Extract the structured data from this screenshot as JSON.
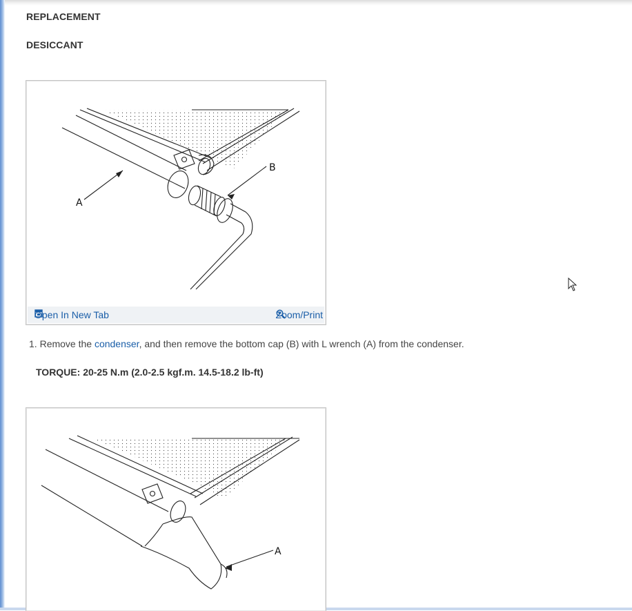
{
  "headings": {
    "replacement": "REPLACEMENT",
    "desiccant": "DESICCANT"
  },
  "figure1": {
    "open_tab_label": "Open In New Tab",
    "zoom_label": "Zoom/Print",
    "callouts": [
      "A",
      "B"
    ]
  },
  "step1": {
    "number": "1.",
    "text_before": " Remove the ",
    "link": "condenser",
    "text_after": ", and then remove the bottom cap (B) with L wrench (A) from the condenser."
  },
  "torque": "TORQUE: 20-25 N.m (2.0-2.5 kgf.m. 14.5-18.2 lb-ft)",
  "figure2": {
    "callouts": [
      "A"
    ]
  },
  "icons": {
    "open_tab": "open-in-new-tab-icon",
    "zoom": "zoom-in-icon",
    "cursor": "mouse-pointer-icon"
  },
  "colors": {
    "link": "#1a5ea8",
    "bar": "#eff2f5",
    "text": "#333333"
  }
}
